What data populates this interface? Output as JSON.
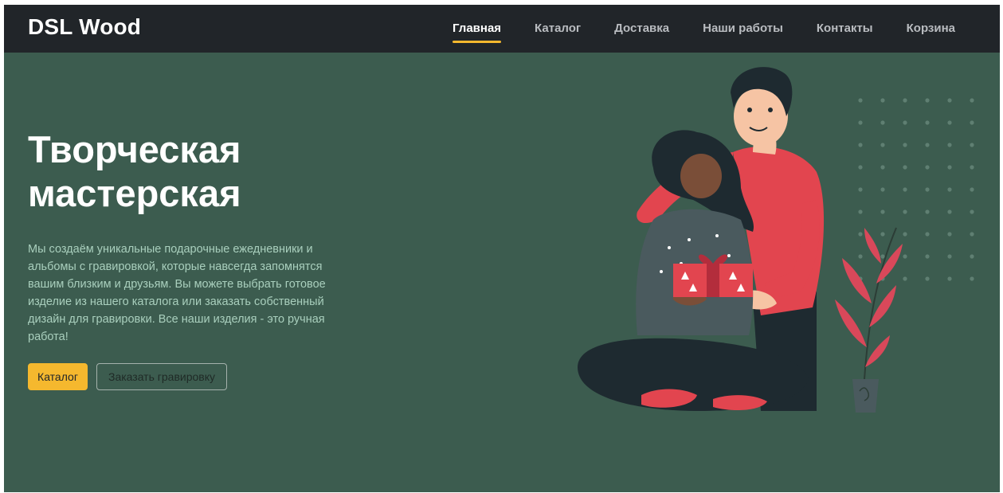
{
  "navbar": {
    "brand": "DSL Wood",
    "links": [
      {
        "label": "Главная",
        "active": true
      },
      {
        "label": "Каталог",
        "active": false
      },
      {
        "label": "Доставка",
        "active": false
      },
      {
        "label": "Наши работы",
        "active": false
      },
      {
        "label": "Контакты",
        "active": false
      },
      {
        "label": "Корзина",
        "active": false
      }
    ]
  },
  "hero": {
    "title_line1": "Творческая",
    "title_line2": "мастерская",
    "description": "Мы создаём уникальные подарочные ежедневники и альбомы с гравировкой, которые навсегда запомнятся вашим близким и друзьям. Вы можете выбрать готовое изделие из нашего каталога или заказать собственный дизайн для гравировки. Все наши изделия - это ручная работа!",
    "buttons": {
      "catalog": "Каталог",
      "order": "Заказать гравировку"
    },
    "illustration": "couple-gift-illustration"
  },
  "colors": {
    "navbar_bg": "#212529",
    "hero_bg": "#3c5c4f",
    "accent": "#f5b82e",
    "text_muted": "#a9cfbd"
  }
}
